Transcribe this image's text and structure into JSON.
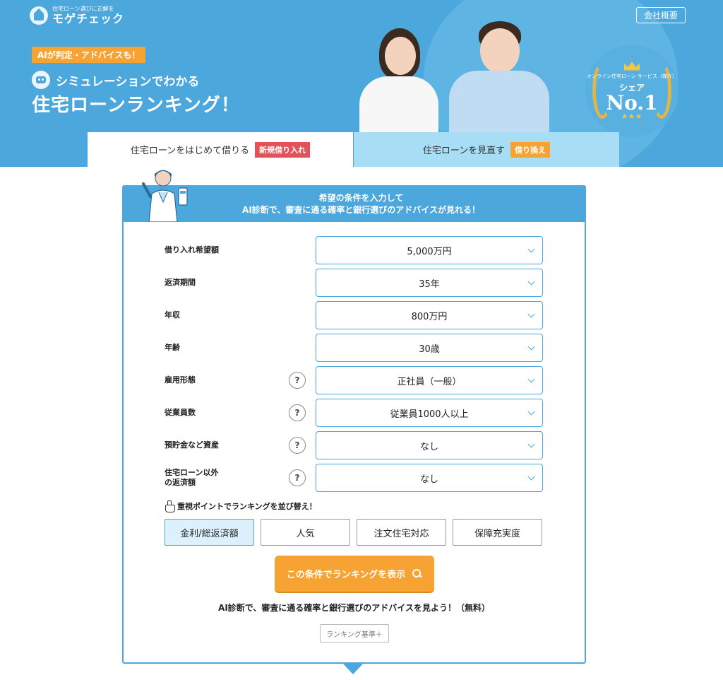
{
  "header": {
    "logo_tagline": "住宅ローン選びに正解を",
    "logo_name": "モゲチェック",
    "company_link": "会社概要"
  },
  "hero": {
    "badge": "AIが判定・アドバイスも！",
    "subtitle": "シミュレーションでわかる",
    "title": "住宅ローンランキング！",
    "award": {
      "caption": "オンライン住宅ローン サービス（媒介）",
      "share": "シェア",
      "rank": "No.1",
      "stars": "★★★"
    }
  },
  "tabs": [
    {
      "label": "住宅ローンをはじめて借りる",
      "tag": "新規借り入れ",
      "tag_color": "#e45157"
    },
    {
      "label": "住宅ローンを見直す",
      "tag": "借り換え",
      "tag_color": "#f7a334"
    }
  ],
  "form": {
    "heading_line1": "希望の条件を入力して",
    "heading_line2": "AI診断で、審査に通る確率と銀行選びのアドバイスが見れる！",
    "fields": [
      {
        "label": "借り入れ希望額",
        "value": "5,000万円",
        "help": ""
      },
      {
        "label": "返済期間",
        "value": "35年",
        "help": ""
      },
      {
        "label": "年収",
        "value": "800万円",
        "help": ""
      },
      {
        "label": "年齢",
        "value": "30歳",
        "help": ""
      },
      {
        "label": "雇用形態",
        "value": "正社員（一般）",
        "help": "?"
      },
      {
        "label": "従業員数",
        "value": "従業員1000人以上",
        "help": "?"
      },
      {
        "label": "預貯金など資産",
        "value": "なし",
        "help": "?"
      },
      {
        "label": "住宅ローン以外\nの返済額",
        "value": "なし",
        "help": "?"
      }
    ],
    "sort_label": "重視ポイントでランキングを並び替え！",
    "sort_options": [
      "金利/総返済額",
      "人気",
      "注文住宅対応",
      "保障充実度"
    ],
    "sort_selected": "金利/総返済額",
    "submit": "この条件でランキングを表示",
    "note": "AI診断で、審査に通る確率と銀行選びのアドバイスを見よう！（無料）",
    "basis_button": "ランキング基準＋"
  },
  "colors": {
    "primary": "#4ba7dc",
    "accent": "#f7a334",
    "tag_red": "#e45157",
    "tab_inactive": "#a7def6"
  },
  "icons": {
    "logo": "house-icon",
    "robot": "robot-icon",
    "help": "question-icon",
    "chevron": "chevron-down-icon",
    "hand": "pointing-hand-icon",
    "search": "search-icon"
  }
}
